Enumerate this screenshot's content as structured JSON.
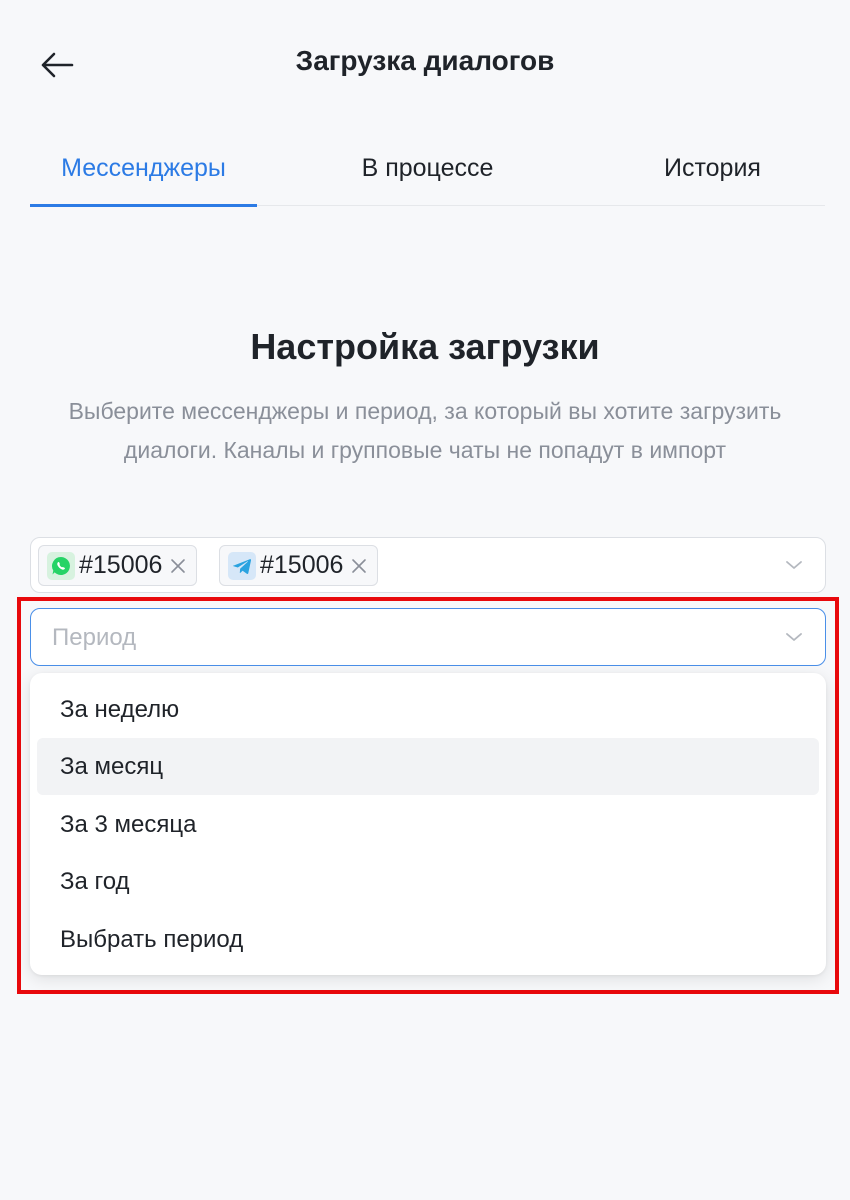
{
  "header": {
    "title": "Загрузка диалогов",
    "back_icon": "arrow-left-icon"
  },
  "tabs": [
    {
      "label": "Мессенджеры",
      "active": true
    },
    {
      "label": "В процессе",
      "active": false
    },
    {
      "label": "История",
      "active": false
    }
  ],
  "section": {
    "title": "Настройка загрузки",
    "description": "Выберите мессенджеры и период, за который вы хотите загрузить диалоги. Каналы и групповые чаты не попадут в импорт"
  },
  "messengers": {
    "chips": [
      {
        "icon": "whatsapp-icon",
        "label": "#15006"
      },
      {
        "icon": "telegram-icon",
        "label": "#15006"
      }
    ]
  },
  "period": {
    "placeholder": "Период",
    "options": [
      "За неделю",
      "За месяц",
      "За 3 месяца",
      "За год",
      "Выбрать период"
    ],
    "hovered_option": "За месяц"
  },
  "colors": {
    "accent": "#2c7be5",
    "highlight": "#e8090c",
    "whatsapp": "#25d366",
    "telegram": "#2aa3e0"
  }
}
